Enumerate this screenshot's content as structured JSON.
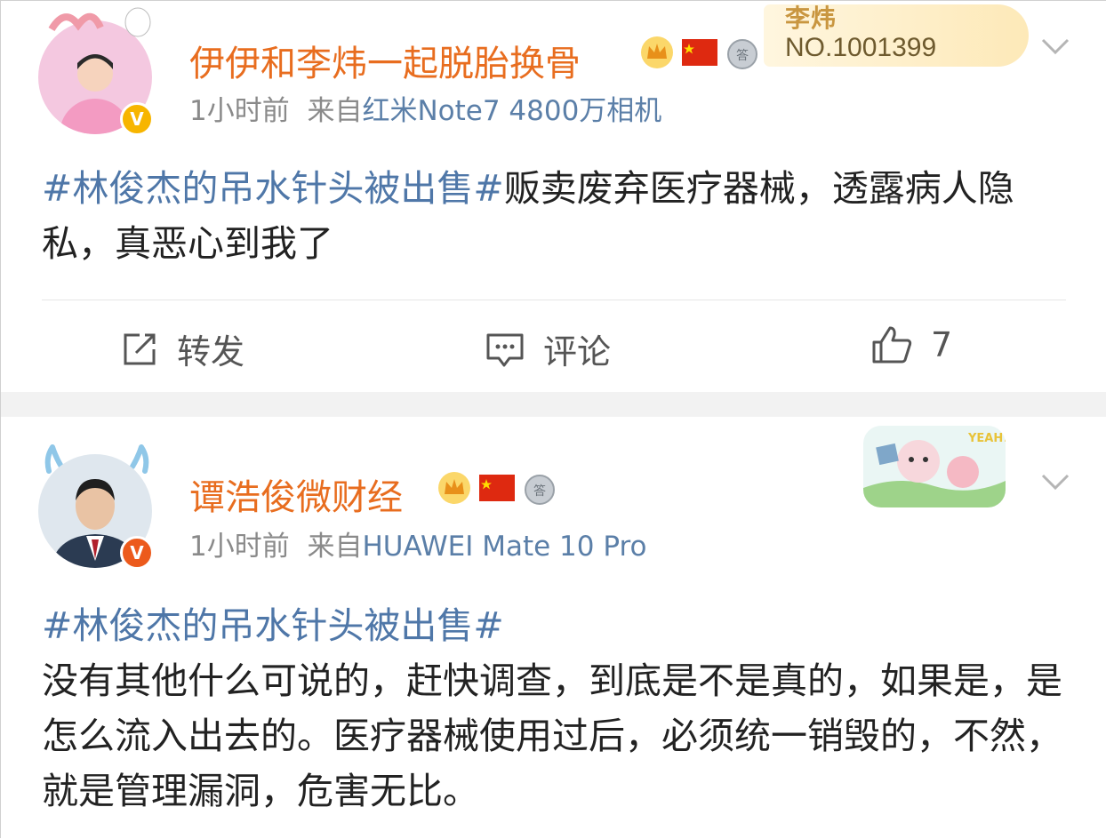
{
  "post1": {
    "username": "伊伊和李炜一起脱胎换骨",
    "time": "1小时前",
    "source_prefix": "来自",
    "source": "红米Note7 4800万相机",
    "topic": "#林俊杰的吊水针头被出售#",
    "text": "贩卖废弃医疗器械，透露病人隐私，真恶心到我了",
    "fan_card": {
      "name": "李炜",
      "number": "NO.1001399"
    },
    "actions": {
      "repost_label": "转发",
      "comment_label": "评论",
      "like_count": "7"
    }
  },
  "post2": {
    "username": "谭浩俊微财经",
    "time": "1小时前",
    "source_prefix": "来自",
    "source": "HUAWEI Mate 10 Pro",
    "topic": "#林俊杰的吊水针头被出售#",
    "text": "没有其他什么可说的，赶快调查，到底是不是真的，如果是，是怎么流入出去的。医疗器械使用过后，必须统一销毁的，不然，就是管理漏洞，危害无比。",
    "sticker_text": "YEAH!"
  },
  "icons": [
    "crown-icon",
    "china-flag-icon",
    "medal-icon",
    "chevron-down-icon",
    "repost-icon",
    "comment-icon",
    "like-icon",
    "verified-icon"
  ],
  "colors": {
    "username": "#e86d1f",
    "topic": "#4f77a8",
    "meta": "#8a8a8a",
    "separator": "#f2f2f2",
    "verify_yellow": "#f7b500",
    "verify_orange": "#ec5a1c"
  }
}
